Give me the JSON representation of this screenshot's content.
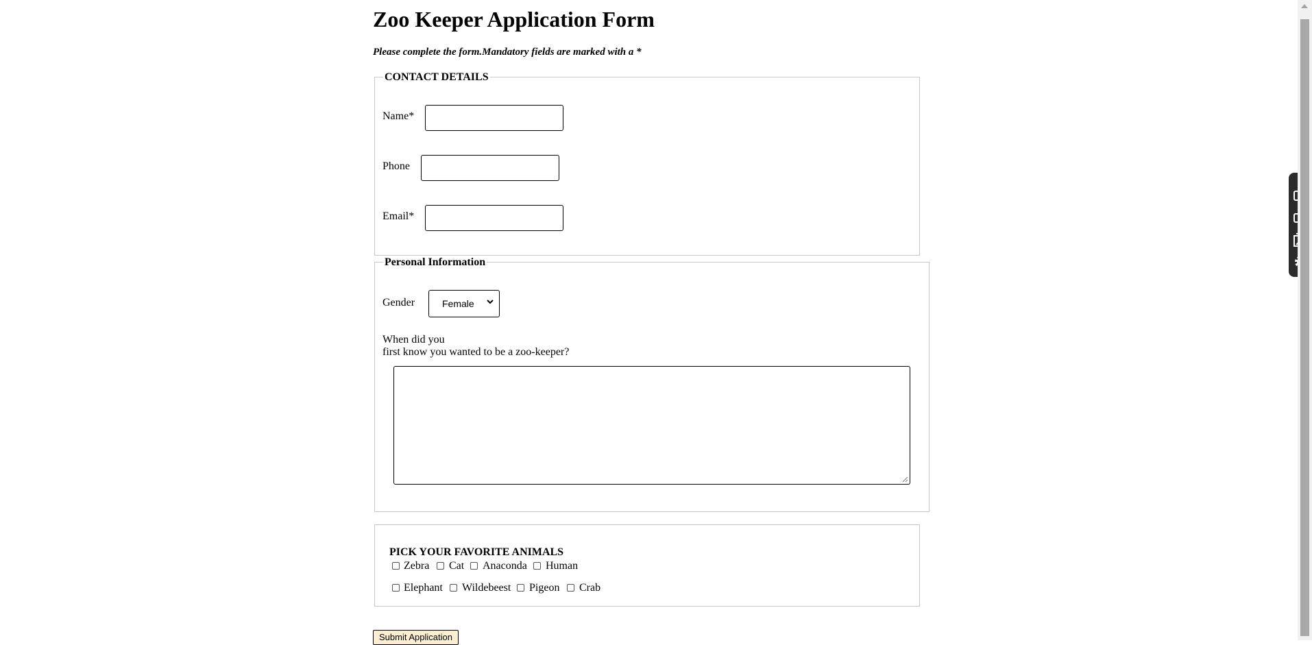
{
  "header": {
    "title": "Zoo Keeper Application Form",
    "intro": "Please complete the form.Mandatory fields are marked with a *"
  },
  "contact": {
    "legend": "CONTACT DETAILS",
    "name_label": "Name*",
    "name_value": "",
    "phone_label": "Phone",
    "phone_value": "",
    "email_label": "Email*",
    "email_value": ""
  },
  "personal": {
    "legend": "Personal Information",
    "gender_label": "Gender",
    "gender_selected": "Female",
    "question_line1": "When did you",
    "question_line2": "first know you wanted to be a zoo-keeper?",
    "answer_value": ""
  },
  "animals": {
    "heading": "PICK YOUR FAVORITE ANIMALS",
    "options": [
      "Zebra",
      "Cat",
      "Anaconda",
      "Human",
      "Elephant",
      "Wildebeest",
      "Pigeon",
      "Crab"
    ]
  },
  "submit_label": "Submit Application",
  "toolbar": {
    "icons": [
      "camera-icon",
      "video-icon",
      "gallery-icon",
      "gear-icon"
    ]
  }
}
